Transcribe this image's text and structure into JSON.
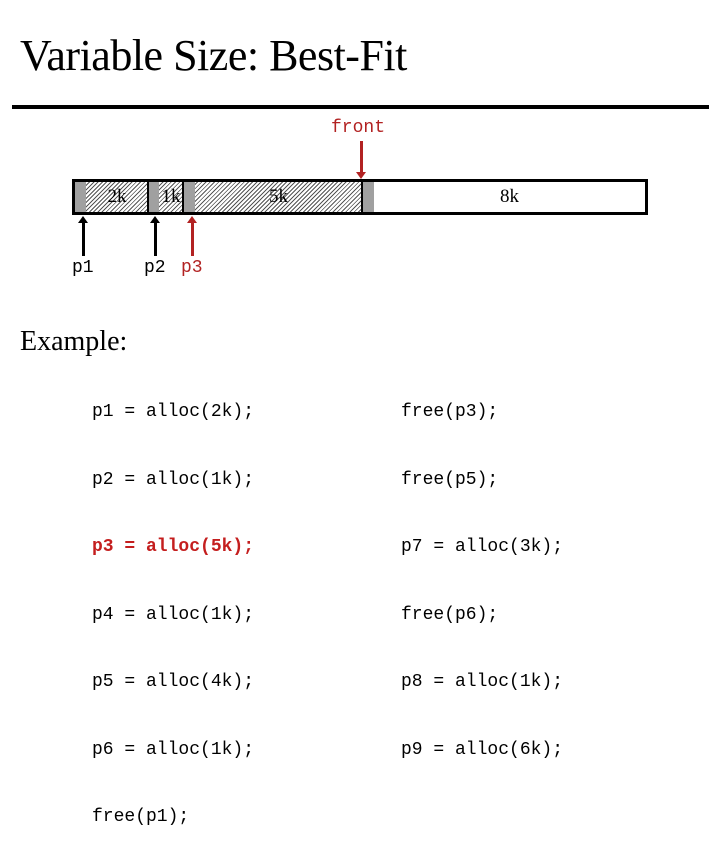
{
  "title": "Variable Size: Best-Fit",
  "diagram": {
    "front_label": "front",
    "blocks": [
      {
        "label": "2k",
        "state": "allocated"
      },
      {
        "label": "1k",
        "state": "allocated"
      },
      {
        "label": "5k",
        "state": "allocated"
      },
      {
        "label": "8k",
        "state": "free"
      }
    ],
    "pointers": [
      {
        "label": "p1",
        "color": "#000000"
      },
      {
        "label": "p2",
        "color": "#000000"
      },
      {
        "label": "p3",
        "color": "#b22222"
      }
    ],
    "colors": {
      "header": "#a0a0a0",
      "highlight": "#b22222"
    }
  },
  "example": {
    "label": "Example:",
    "left_code": [
      {
        "text": "p1 = alloc(2k);",
        "highlight": false
      },
      {
        "text": "p2 = alloc(1k);",
        "highlight": false
      },
      {
        "text": "p3 = alloc(5k);",
        "highlight": true
      },
      {
        "text": "p4 = alloc(1k);",
        "highlight": false
      },
      {
        "text": "p5 = alloc(4k);",
        "highlight": false
      },
      {
        "text": "p6 = alloc(1k);",
        "highlight": false
      },
      {
        "text": "free(p1);",
        "highlight": false
      }
    ],
    "right_code": [
      {
        "text": "free(p3);",
        "highlight": false
      },
      {
        "text": "free(p5);",
        "highlight": false
      },
      {
        "text": "p7 = alloc(3k);",
        "highlight": false
      },
      {
        "text": "free(p6);",
        "highlight": false
      },
      {
        "text": "p8 = alloc(1k);",
        "highlight": false
      },
      {
        "text": "p9 = alloc(6k);",
        "highlight": false
      }
    ]
  }
}
